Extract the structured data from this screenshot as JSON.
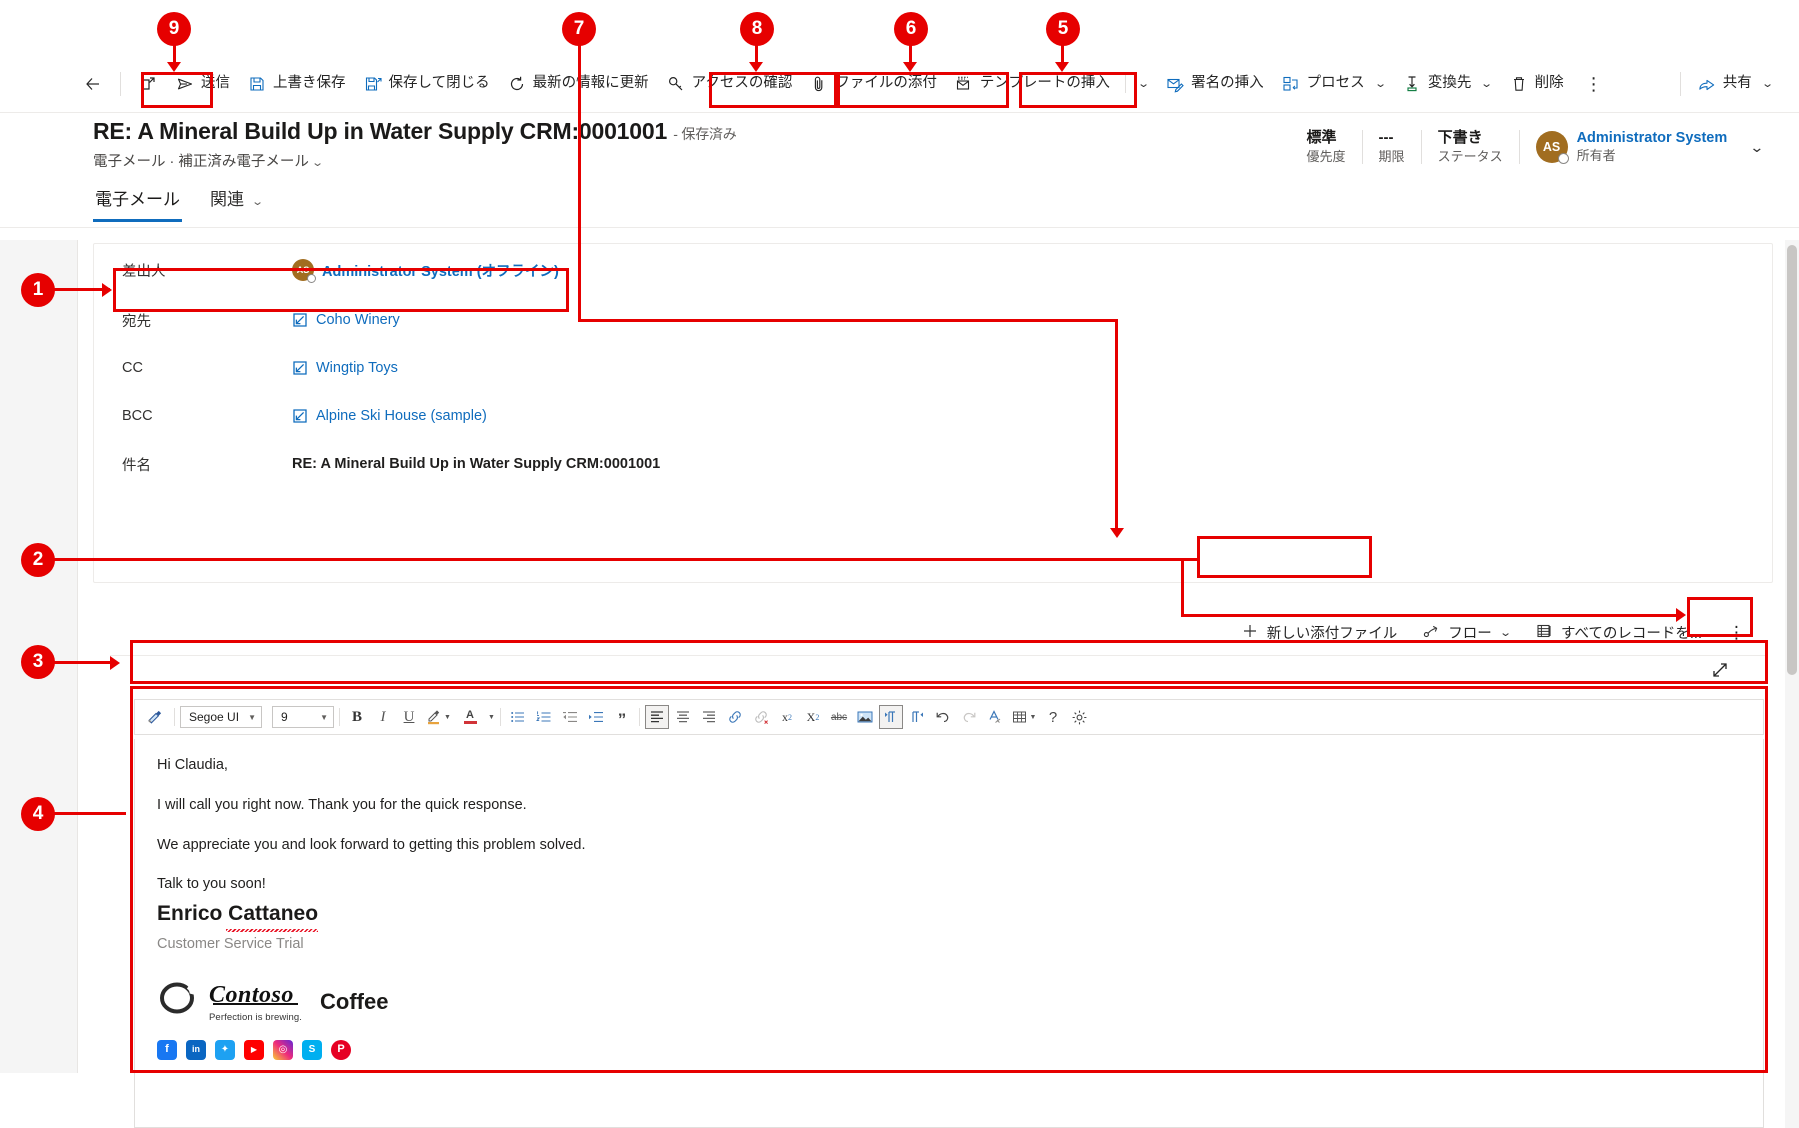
{
  "command_bar": {
    "back_icon": "back-arrow-icon",
    "popout_icon": "popout-icon",
    "items": [
      {
        "id": "send",
        "label": "送信",
        "icon": "send-icon",
        "has_chevron": false
      },
      {
        "id": "save",
        "label": "上書き保存",
        "icon": "save-icon",
        "has_chevron": false
      },
      {
        "id": "save_close",
        "label": "保存して閉じる",
        "icon": "save-close-icon",
        "has_chevron": false
      },
      {
        "id": "refresh",
        "label": "最新の情報に更新",
        "icon": "refresh-icon",
        "has_chevron": false
      },
      {
        "id": "check_access",
        "label": "アクセスの確認",
        "icon": "key-icon",
        "has_chevron": false
      },
      {
        "id": "attach_file",
        "label": "ファイルの添付",
        "icon": "paperclip-icon",
        "has_chevron": false
      },
      {
        "id": "insert_template",
        "label": "テンプレートの挿入",
        "icon": "template-icon",
        "has_chevron": true
      },
      {
        "id": "insert_signature",
        "label": "署名の挿入",
        "icon": "signature-icon",
        "has_chevron": false
      },
      {
        "id": "process",
        "label": "プロセス",
        "icon": "process-icon",
        "has_chevron": true
      },
      {
        "id": "convert_to",
        "label": "変換先",
        "icon": "convert-icon",
        "has_chevron": true
      },
      {
        "id": "delete",
        "label": "削除",
        "icon": "trash-icon",
        "has_chevron": false
      }
    ],
    "overflow_label": "⋮",
    "share": {
      "label": "共有",
      "icon": "share-icon",
      "has_chevron": true
    }
  },
  "record": {
    "title": "RE: A Mineral Build Up in Water Supply CRM:0001001",
    "saved_state": "- 保存済み",
    "subtitle_entity": "電子メール",
    "subtitle_sep": "·",
    "subtitle_form": "補正済み電子メール",
    "header_fields": [
      {
        "value": "標準",
        "label": "優先度"
      },
      {
        "value": "---",
        "label": "期限"
      },
      {
        "value": "下書き",
        "label": "ステータス"
      }
    ],
    "owner": {
      "initials": "AS",
      "name": "Administrator System",
      "role": "所有者"
    }
  },
  "tabs": [
    {
      "id": "email",
      "label": "電子メール",
      "active": true,
      "chevron": false
    },
    {
      "id": "related",
      "label": "関連",
      "active": false,
      "chevron": true
    }
  ],
  "form": {
    "rows": [
      {
        "key": "差出人",
        "type": "user",
        "initials": "AS",
        "value": "Administrator System (オフライン)"
      },
      {
        "key": "宛先",
        "type": "lookup",
        "value": "Coho Winery"
      },
      {
        "key": "CC",
        "type": "lookup",
        "value": "Wingtip Toys"
      },
      {
        "key": "BCC",
        "type": "lookup",
        "value": "Alpine Ski House (sample)"
      },
      {
        "key": "件名",
        "type": "text",
        "value": "RE: A Mineral Build Up in Water Supply CRM:0001001"
      }
    ]
  },
  "attachment_bar": {
    "new_attachment": {
      "label": "新しい添付ファイル",
      "icon": "plus-icon"
    },
    "flow": {
      "label": "フロー",
      "icon": "flow-icon",
      "has_chevron": true
    },
    "run_report": {
      "label": "すべてのレコードを...",
      "icon": "grid-icon"
    },
    "overflow_label": "⋮",
    "expand_icon": "expand-diagonal-icon"
  },
  "rte_toolbar": {
    "format_painter_icon": "format-painter-icon",
    "font_family": "Segoe UI",
    "font_size": "9",
    "buttons": [
      {
        "id": "bold",
        "label": "B",
        "icon": "bold-icon"
      },
      {
        "id": "italic",
        "label": "I",
        "icon": "italic-icon"
      },
      {
        "id": "underline",
        "label": "U",
        "icon": "underline-icon"
      },
      {
        "id": "highlight",
        "label": "",
        "icon": "highlight-icon"
      },
      {
        "id": "font-color",
        "label": "A",
        "icon": "font-color-icon"
      },
      {
        "id": "bullet-list",
        "label": "",
        "icon": "bulleted-list-icon"
      },
      {
        "id": "numbered-list",
        "label": "",
        "icon": "numbered-list-icon"
      },
      {
        "id": "decrease-indent",
        "label": "",
        "icon": "decrease-indent-icon"
      },
      {
        "id": "increase-indent",
        "label": "",
        "icon": "increase-indent-icon"
      },
      {
        "id": "blockquote",
        "label": "",
        "icon": "blockquote-icon"
      },
      {
        "id": "align-left",
        "label": "",
        "icon": "align-left-icon"
      },
      {
        "id": "align-center",
        "label": "",
        "icon": "align-center-icon"
      },
      {
        "id": "align-right",
        "label": "",
        "icon": "align-right-icon"
      },
      {
        "id": "insert-link",
        "label": "",
        "icon": "link-icon"
      },
      {
        "id": "remove-link",
        "label": "",
        "icon": "unlink-icon"
      },
      {
        "id": "superscript",
        "label": "",
        "icon": "superscript-icon"
      },
      {
        "id": "subscript",
        "label": "",
        "icon": "subscript-icon"
      },
      {
        "id": "strikethrough",
        "label": "abc",
        "icon": "strikethrough-icon"
      },
      {
        "id": "insert-image",
        "label": "",
        "icon": "image-icon"
      },
      {
        "id": "ltr",
        "label": "",
        "icon": "left-to-right-icon"
      },
      {
        "id": "rtl",
        "label": "",
        "icon": "right-to-left-icon"
      },
      {
        "id": "undo",
        "label": "",
        "icon": "undo-icon"
      },
      {
        "id": "redo",
        "label": "",
        "icon": "redo-icon"
      },
      {
        "id": "clear-format",
        "label": "",
        "icon": "clear-formatting-icon"
      },
      {
        "id": "table",
        "label": "",
        "icon": "table-icon"
      },
      {
        "id": "help",
        "label": "?",
        "icon": "help-icon"
      },
      {
        "id": "settings",
        "label": "",
        "icon": "gear-icon"
      }
    ]
  },
  "body": {
    "paragraphs": [
      "Hi Claudia,",
      "I will call you right now. Thank you for the quick response.",
      "We appreciate you and look forward to getting this problem solved.",
      "Talk to you soon!"
    ],
    "signature_name": "Enrico Cattaneo",
    "signature_role": "Customer Service Trial",
    "logo_word": "Contoso",
    "logo_tagline": "Perfection is brewing.",
    "logo_product": "Coffee",
    "socials": [
      {
        "id": "facebook",
        "glyph": "f",
        "color": "#1877F2",
        "name": "facebook-icon"
      },
      {
        "id": "linkedin",
        "glyph": "in",
        "color": "#0A66C2",
        "name": "linkedin-icon"
      },
      {
        "id": "twitter",
        "glyph": "🐦",
        "color": "#1DA1F2",
        "name": "twitter-icon"
      },
      {
        "id": "youtube",
        "glyph": "▶",
        "color": "#FF0000",
        "name": "youtube-icon"
      },
      {
        "id": "instagram",
        "glyph": "◎",
        "color": "#C13584",
        "name": "instagram-icon"
      },
      {
        "id": "skype",
        "glyph": "S",
        "color": "#00AFF0",
        "name": "skype-icon"
      },
      {
        "id": "pinterest",
        "glyph": "P",
        "color": "#E60023",
        "name": "pinterest-icon"
      }
    ]
  },
  "callouts": [
    {
      "n": "1"
    },
    {
      "n": "2"
    },
    {
      "n": "3"
    },
    {
      "n": "4"
    },
    {
      "n": "5"
    },
    {
      "n": "6"
    },
    {
      "n": "7"
    },
    {
      "n": "8"
    },
    {
      "n": "9"
    }
  ],
  "colors": {
    "accent": "#0f6cbd",
    "callout": "#e60000",
    "avatar": "#a16d20"
  }
}
